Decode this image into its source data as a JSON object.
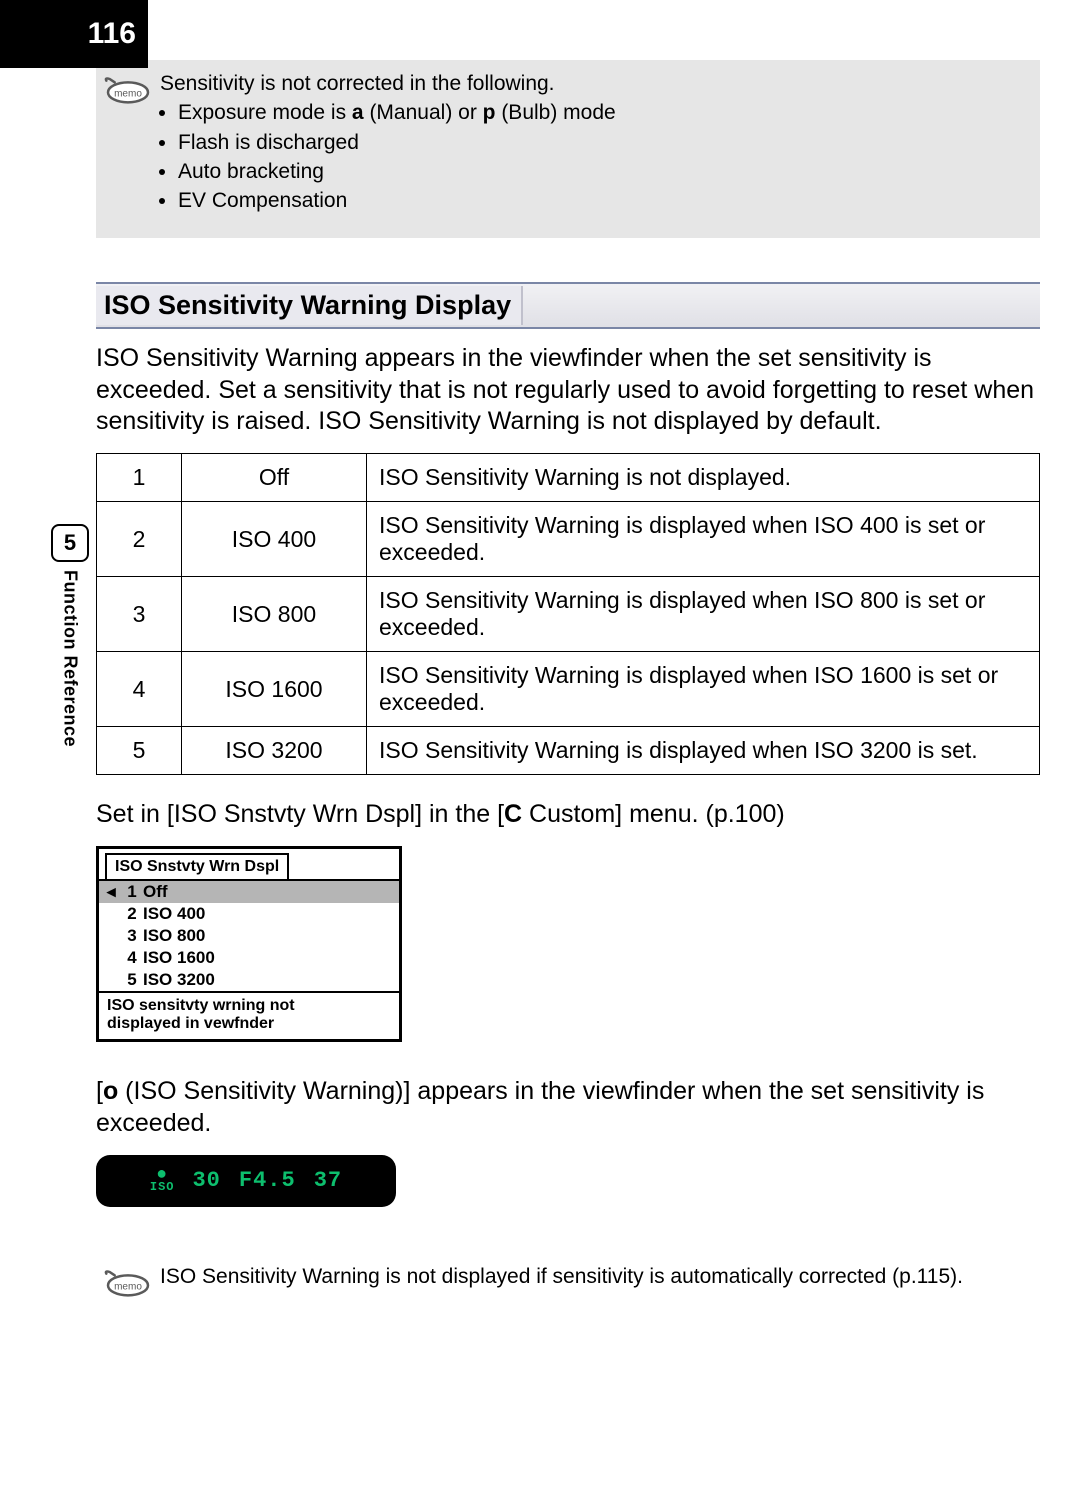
{
  "page_number": "116",
  "chapter_number": "5",
  "chapter_label": "Function Reference",
  "memo1": {
    "lead": "Sensitivity is not corrected in the following.",
    "bullets": [
      [
        "Exposure mode is ",
        "a",
        "  (Manual) or ",
        "p",
        "  (Bulb) mode"
      ],
      [
        "Flash is discharged"
      ],
      [
        "Auto bracketing"
      ],
      [
        "EV Compensation"
      ]
    ]
  },
  "section_heading": "ISO Sensitivity Warning Display",
  "intro_paragraph": "ISO Sensitivity Warning appears in the viewfinder when the set sensitivity is exceeded. Set a sensitivity that is not regularly used to avoid forgetting to reset when sensitivity is raised. ISO Sensitivity Warning is not displayed by default.",
  "table": [
    {
      "n": "1",
      "label": "Off",
      "desc": "ISO Sensitivity Warning is not displayed."
    },
    {
      "n": "2",
      "label": "ISO 400",
      "desc": "ISO Sensitivity Warning is displayed when ISO 400 is set or exceeded."
    },
    {
      "n": "3",
      "label": "ISO 800",
      "desc": "ISO Sensitivity Warning is displayed when ISO 800 is set or exceeded."
    },
    {
      "n": "4",
      "label": "ISO 1600",
      "desc": "ISO Sensitivity Warning is displayed when ISO 1600 is set or exceeded."
    },
    {
      "n": "5",
      "label": "ISO 3200",
      "desc": "ISO Sensitivity Warning is displayed when ISO 3200 is set."
    }
  ],
  "set_line_pre": "Set in [ISO Snstvty Wrn Dspl] in the [",
  "set_line_bold": "C",
  "set_line_post": " Custom] menu. (p.100)",
  "menu_screenshot": {
    "title": "ISO Snstvty Wrn Dspl",
    "rows": [
      {
        "n": "1",
        "label": "Off",
        "selected": true
      },
      {
        "n": "2",
        "label": "ISO 400",
        "selected": false
      },
      {
        "n": "3",
        "label": "ISO 800",
        "selected": false
      },
      {
        "n": "4",
        "label": "ISO 1600",
        "selected": false
      },
      {
        "n": "5",
        "label": "ISO 3200",
        "selected": false
      }
    ],
    "status_line1": "ISO sensitvty wrning not",
    "status_line2": "displayed in vewfnder"
  },
  "vf_line_pre": "[",
  "vf_line_bold": "o",
  "vf_line_post": "    (ISO Sensitivity Warning)] appears in the viewfinder when the set sensitivity is exceeded.",
  "viewfinder": {
    "shutter": "30",
    "aperture": "F4.5",
    "count": "37"
  },
  "memo2": {
    "text": "ISO Sensitivity Warning is not displayed if sensitivity is automatically corrected (p.115)."
  }
}
